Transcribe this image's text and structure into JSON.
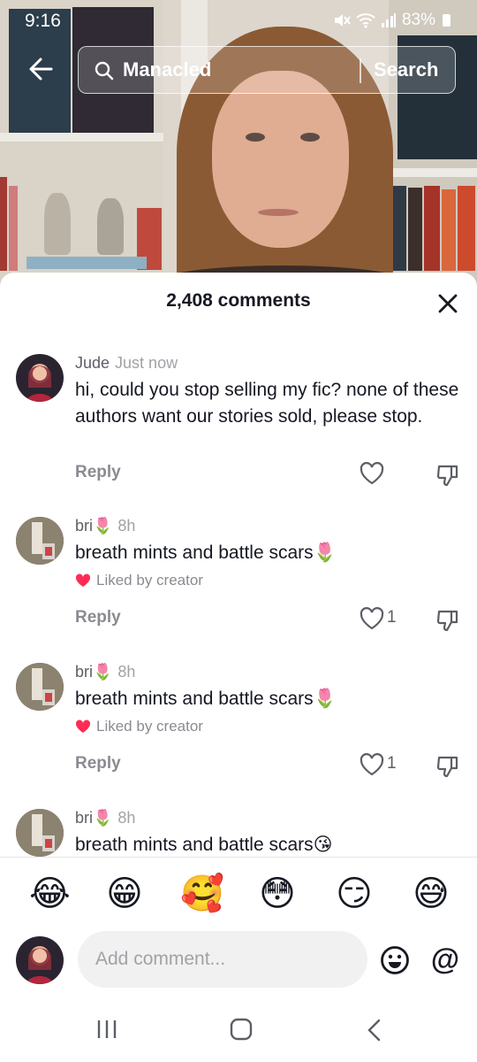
{
  "status": {
    "time": "9:16",
    "battery": "83%"
  },
  "search": {
    "query": "Manacled",
    "button": "Search"
  },
  "comments_sheet": {
    "title": "2,408 comments",
    "comments": [
      {
        "username": "Jude",
        "time": "Just now",
        "text": "hi, could you stop selling my fic? none of these authors want our stories sold, please stop.",
        "liked_by_creator": "",
        "reply": "Reply",
        "likes": ""
      },
      {
        "username": "bri🌷",
        "time": "8h",
        "text": "breath mints and battle scars🌷",
        "liked_by_creator": "Liked by creator",
        "reply": "Reply",
        "likes": "1"
      },
      {
        "username": "bri🌷",
        "time": "8h",
        "text": "breath mints and battle scars🌷",
        "liked_by_creator": "Liked by creator",
        "reply": "Reply",
        "likes": "1"
      },
      {
        "username": "bri🌷",
        "time": "8h",
        "text": "breath mints and battle scars😘",
        "liked_by_creator": "",
        "reply": "",
        "likes": ""
      }
    ]
  },
  "emoji_bar": [
    "😂",
    "😁",
    "🥰",
    "😳",
    "😏",
    "😅"
  ],
  "composer": {
    "placeholder": "Add comment...",
    "mention": "@"
  },
  "colors": {
    "like_red": "#fe2c55",
    "text_primary": "#161823",
    "text_secondary": "#8a8b91"
  }
}
